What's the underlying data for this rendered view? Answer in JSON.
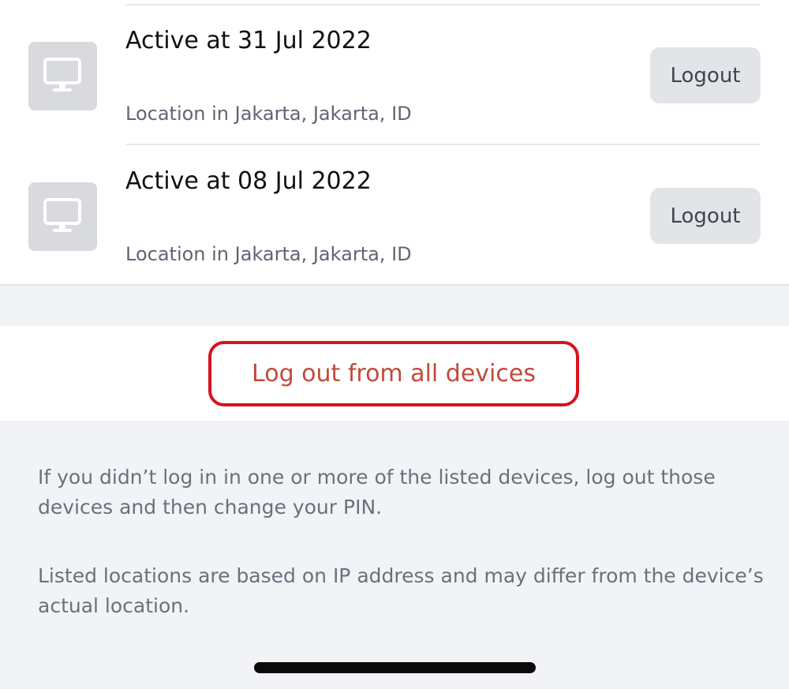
{
  "sessions": [
    {
      "title": "Active at 31 Jul 2022",
      "location": "Location in Jakarta, Jakarta, ID",
      "logout_label": "Logout",
      "icon": "desktop-monitor-icon"
    },
    {
      "title": "Active at 08 Jul 2022",
      "location": "Location in Jakarta, Jakarta, ID",
      "logout_label": "Logout",
      "icon": "desktop-monitor-icon"
    }
  ],
  "logout_all": {
    "label": "Log out from all devices",
    "highlight_color": "#d7131e",
    "text_color": "#c24a3a"
  },
  "notes": [
    "If you didn’t log in in one or more of the listed devices, log out those devices and then change your PIN.",
    "Listed locations are based on IP address and may differ from the device’s actual location."
  ],
  "colors": {
    "page_background": "#f2f3f7",
    "card_background": "#ffffff",
    "device_tile": "#d9dade",
    "logout_button": "#e3e4e8"
  }
}
